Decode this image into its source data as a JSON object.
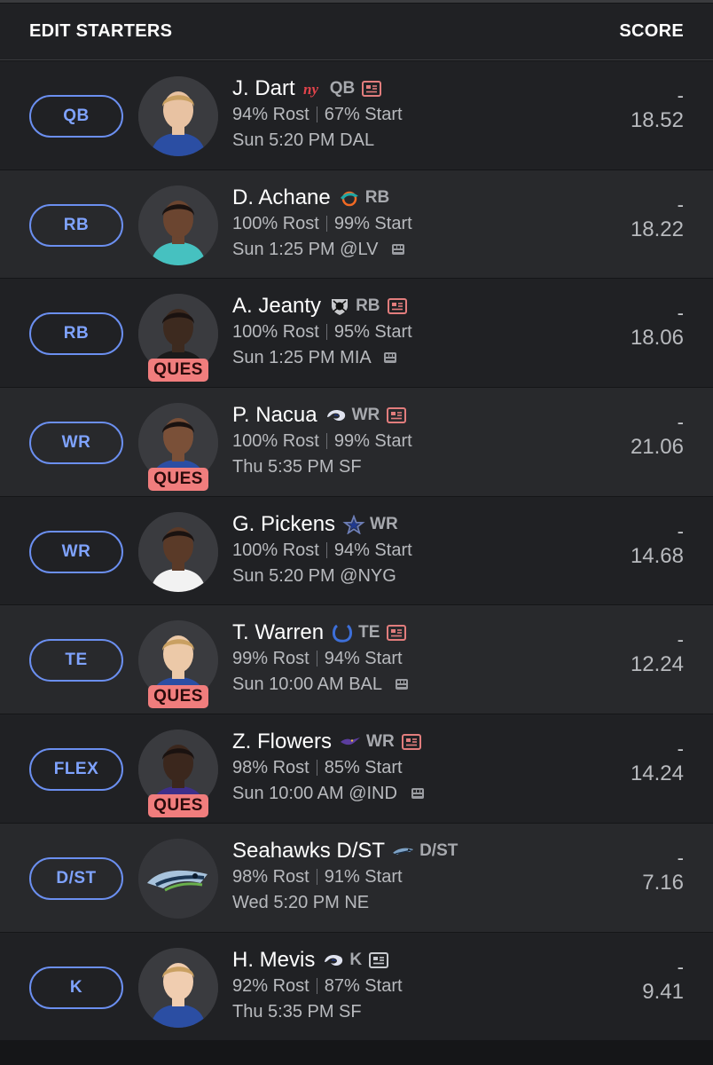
{
  "header": {
    "title": "EDIT STARTERS",
    "score_label": "SCORE"
  },
  "colors": {
    "accent": "#6b8ff0",
    "ques_badge": "#f07d7d",
    "news_icon": "#e27d7d"
  },
  "players": [
    {
      "slot": "QB",
      "name": "J. Dart",
      "team_icon": "giants-logo-icon",
      "pos": "QB",
      "news": true,
      "news_color": "#e27d7d",
      "ques": "",
      "rost": "94% Rost",
      "start": "67% Start",
      "game": "Sun 5:20 PM DAL",
      "weather": false,
      "dash": "-",
      "score": "18.52"
    },
    {
      "slot": "RB",
      "name": "D. Achane",
      "team_icon": "dolphins-logo-icon",
      "pos": "RB",
      "news": false,
      "ques": "",
      "rost": "100% Rost",
      "start": "99% Start",
      "game": "Sun 1:25 PM @LV",
      "weather": true,
      "dash": "-",
      "score": "18.22"
    },
    {
      "slot": "RB",
      "name": "A. Jeanty",
      "team_icon": "raiders-logo-icon",
      "pos": "RB",
      "news": true,
      "news_color": "#e27d7d",
      "ques": "QUES",
      "rost": "100% Rost",
      "start": "95% Start",
      "game": "Sun 1:25 PM MIA",
      "weather": true,
      "dash": "-",
      "score": "18.06"
    },
    {
      "slot": "WR",
      "name": "P. Nacua",
      "team_icon": "rams-logo-icon",
      "pos": "WR",
      "news": true,
      "news_color": "#e27d7d",
      "ques": "QUES",
      "rost": "100% Rost",
      "start": "99% Start",
      "game": "Thu 5:35 PM SF",
      "weather": false,
      "dash": "-",
      "score": "21.06"
    },
    {
      "slot": "WR",
      "name": "G. Pickens",
      "team_icon": "cowboys-logo-icon",
      "pos": "WR",
      "news": false,
      "ques": "",
      "rost": "100% Rost",
      "start": "94% Start",
      "game": "Sun 5:20 PM @NYG",
      "weather": false,
      "dash": "-",
      "score": "14.68"
    },
    {
      "slot": "TE",
      "name": "T. Warren",
      "team_icon": "colts-logo-icon",
      "pos": "TE",
      "news": true,
      "news_color": "#e27d7d",
      "ques": "QUES",
      "rost": "99% Rost",
      "start": "94% Start",
      "game": "Sun 10:00 AM BAL",
      "weather": true,
      "dash": "-",
      "score": "12.24"
    },
    {
      "slot": "FLEX",
      "name": "Z. Flowers",
      "team_icon": "ravens-logo-icon",
      "pos": "WR",
      "news": true,
      "news_color": "#e27d7d",
      "ques": "QUES",
      "rost": "98% Rost",
      "start": "85% Start",
      "game": "Sun 10:00 AM @IND",
      "weather": true,
      "dash": "-",
      "score": "14.24"
    },
    {
      "slot": "D/ST",
      "name": "Seahawks D/ST",
      "team_icon": "seahawks-logo-icon",
      "pos": "D/ST",
      "news": false,
      "ques": "",
      "rost": "98% Rost",
      "start": "91% Start",
      "game": "Wed 5:20 PM NE",
      "weather": false,
      "dash": "-",
      "score": "7.16"
    },
    {
      "slot": "K",
      "name": "H. Mevis",
      "team_icon": "rams-logo-icon",
      "pos": "K",
      "news": true,
      "news_color": "#c8cacf",
      "ques": "",
      "rost": "92% Rost",
      "start": "87% Start",
      "game": "Thu 5:35 PM SF",
      "weather": false,
      "dash": "-",
      "score": "9.41"
    }
  ]
}
